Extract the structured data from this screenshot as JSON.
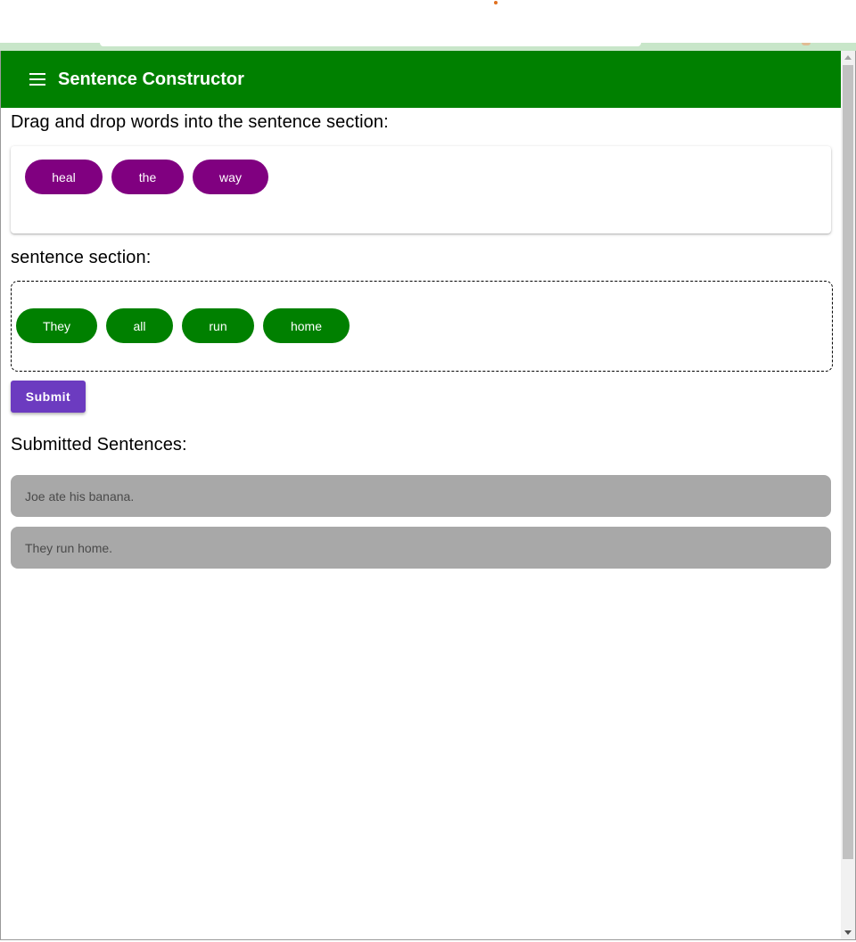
{
  "app": {
    "title": "Sentence Constructor"
  },
  "instruction": "Drag and drop words into the sentence section:",
  "word_bank": {
    "words": [
      "heal",
      "the",
      "way"
    ]
  },
  "sentence_section": {
    "label": "sentence section:",
    "words": [
      "They",
      "all",
      "run",
      "home"
    ]
  },
  "submit_label": "Submit",
  "submitted": {
    "label": "Submitted Sentences:",
    "sentences": [
      "Joe ate his banana.",
      "They run home."
    ]
  },
  "colors": {
    "appbar": "#008000",
    "bank_chip": "#800080",
    "sentence_chip": "#008000",
    "submit_button": "#6c3bc0",
    "submitted_item": "#a8a8a8"
  },
  "icons": {
    "menu": "menu-icon"
  }
}
